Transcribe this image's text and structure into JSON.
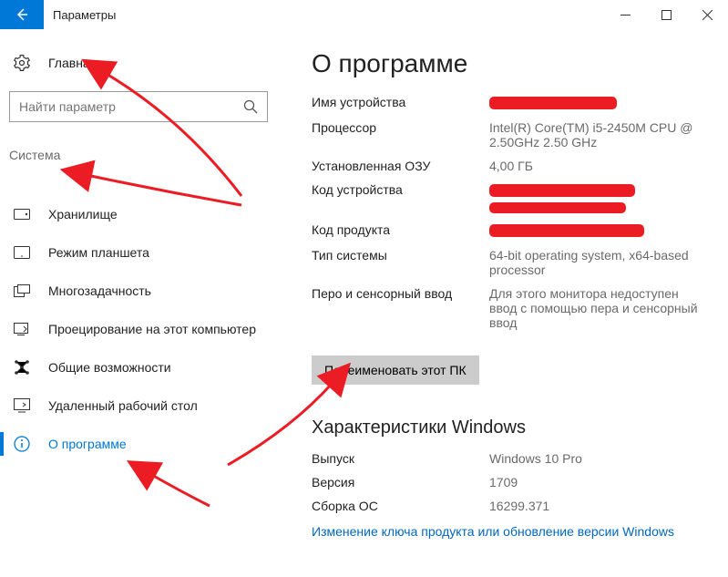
{
  "window": {
    "title": "Параметры"
  },
  "sidebar": {
    "home": "Главная",
    "search_placeholder": "Найти параметр",
    "category": "Система",
    "items": [
      {
        "label": "Хранилище"
      },
      {
        "label": "Режим планшета"
      },
      {
        "label": "Многозадачность"
      },
      {
        "label": "Проецирование на этот компьютер"
      },
      {
        "label": "Общие возможности"
      },
      {
        "label": "Удаленный рабочий стол"
      },
      {
        "label": "О программе"
      }
    ]
  },
  "main": {
    "heading": "О программе",
    "device_specs": {
      "device_name_label": "Имя устройства",
      "processor_label": "Процессор",
      "processor_value": "Intel(R) Core(TM) i5-2450M CPU @ 2.50GHz   2.50 GHz",
      "ram_label": "Установленная ОЗУ",
      "ram_value": "4,00 ГБ",
      "device_id_label": "Код устройства",
      "product_id_label": "Код продукта",
      "system_type_label": "Тип системы",
      "system_type_value": "64-bit operating system, x64-based processor",
      "pen_touch_label": "Перо и сенсорный ввод",
      "pen_touch_value": "Для этого монитора недоступен ввод с помощью пера и сенсорный ввод"
    },
    "rename_button": "Переименовать этот ПК",
    "windows_specs": {
      "heading": "Характеристики Windows",
      "edition_label": "Выпуск",
      "edition_value": "Windows 10 Pro",
      "version_label": "Версия",
      "version_value": "1709",
      "build_label": "Сборка ОС",
      "build_value": "16299.371"
    },
    "product_key_link": "Изменение ключа продукта или обновление версии Windows"
  }
}
